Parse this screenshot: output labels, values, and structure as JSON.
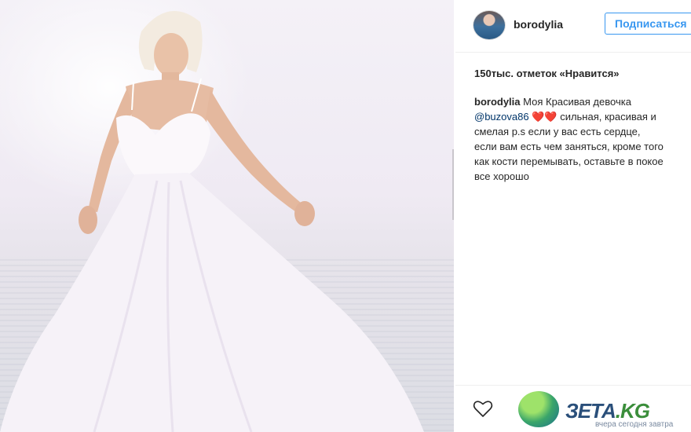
{
  "post": {
    "username": "borodylia",
    "follow_label": "Подписаться",
    "likes": "150тыс. отметок «Нравится»",
    "caption": {
      "author": "borodylia",
      "line1_text": "Моя Красивая девочка",
      "mention": "@buzova86",
      "line2_text": "❤️❤️ сильная, красивая и",
      "line3": "смелая️ p.s если у вас есть сердце,",
      "line4": "если вам есть чем заняться, кроме того",
      "line5": "как кости перемывать, оставьте в покое",
      "line6": "все хорошо"
    }
  },
  "watermark": {
    "brand_main": "ЗЕТА",
    "brand_suffix": ".KG",
    "tagline": "вчера сегодня завтра"
  },
  "icons": {
    "like": "heart-outline-icon",
    "avatar": "profile-avatar"
  },
  "colors": {
    "accent": "#3897f0",
    "text": "#262626",
    "mention": "#003569"
  }
}
